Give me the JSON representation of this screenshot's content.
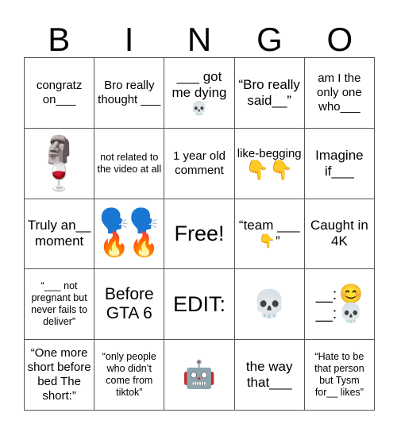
{
  "card": {
    "header_letters": [
      "B",
      "I",
      "N",
      "G",
      "O"
    ],
    "rows": [
      [
        {
          "text": "congratz on___",
          "size": "sz-s"
        },
        {
          "text": "Bro really thought ___",
          "size": "sz-s"
        },
        {
          "text": "___ got me dying 💀",
          "size": "sz-m"
        },
        {
          "text": "“Bro really said__”",
          "size": "sz-m"
        },
        {
          "text": "am I the only one who___",
          "size": "sz-s"
        }
      ],
      [
        {
          "text": "",
          "size": "sz-s",
          "emoji_stack": [
            "🗿",
            "🍷"
          ]
        },
        {
          "text": "not related to the video at all",
          "size": "sz-xs"
        },
        {
          "text": "1 year old comment",
          "size": "sz-s"
        },
        {
          "text": "like-begging",
          "size": "sz-s",
          "emoji_row": "👇👇"
        },
        {
          "text": "Imagine if___",
          "size": "sz-m"
        }
      ],
      [
        {
          "text": "Truly an__ moment",
          "size": "sz-m"
        },
        {
          "text": "",
          "size": "sz-s",
          "emoji_grid": [
            [
              "🗣️",
              "🗣️"
            ],
            [
              "🔥",
              "🔥"
            ]
          ]
        },
        {
          "text": "Free!",
          "size": "sz-xl"
        },
        {
          "text": "“team ___👇”",
          "size": "sz-m"
        },
        {
          "text": "Caught in 4K",
          "size": "sz-m"
        }
      ],
      [
        {
          "text": "“___ not pregnant but never fails to deliver”",
          "size": "sz-xs"
        },
        {
          "text": "Before GTA 6",
          "size": "sz-l"
        },
        {
          "text": "EDIT:",
          "size": "sz-xl"
        },
        {
          "text": "",
          "size": "sz-s",
          "emoji_single": "💀"
        },
        {
          "text": "",
          "size": "sz-s",
          "emoji_pairs": [
            [
              "__:",
              "😊"
            ],
            [
              "__:",
              "💀"
            ]
          ]
        }
      ],
      [
        {
          "text": "“One more short before bed The short:”",
          "size": "sz-s"
        },
        {
          "text": "“only people who didn’t come from tiktok”",
          "size": "sz-xs"
        },
        {
          "text": "",
          "size": "sz-s",
          "emoji_single": "🤖"
        },
        {
          "text": "the way that___",
          "size": "sz-m"
        },
        {
          "text": "“Hate to be that person but Tysm for__ likes”",
          "size": "sz-xs"
        }
      ]
    ]
  }
}
